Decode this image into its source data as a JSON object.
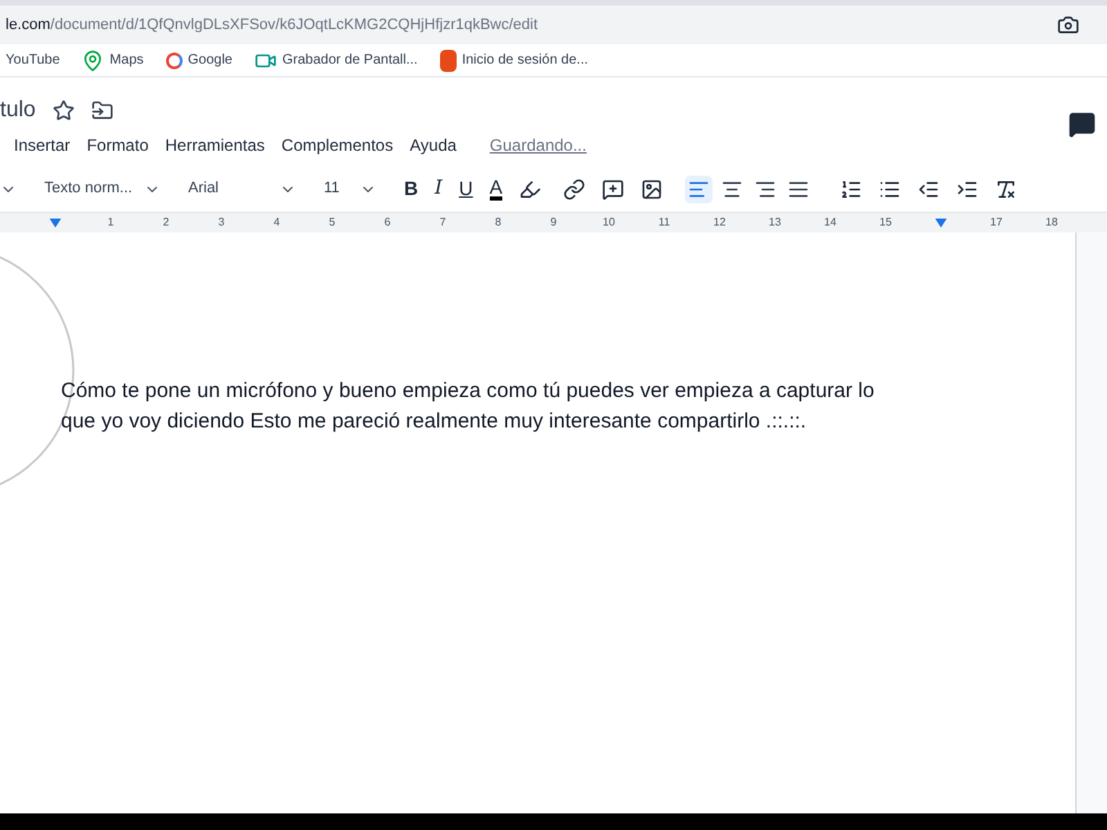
{
  "address_bar": {
    "domain": "le.com",
    "path": "/document/d/1QfQnvlgDLsXFSov/k6JOqtLcKMG2CQHjHfjzr1qkBwc/edit"
  },
  "bookmarks": [
    {
      "label": "YouTube",
      "kind": "plain"
    },
    {
      "label": "Maps",
      "kind": "pin"
    },
    {
      "label": "Google",
      "kind": "google"
    },
    {
      "label": "Grabador de Pantall...",
      "kind": "recorder"
    },
    {
      "label": "Inicio de sesión de...",
      "kind": "office"
    }
  ],
  "document_title": "tulo",
  "menu": [
    "Insertar",
    "Formato",
    "Herramientas",
    "Complementos",
    "Ayuda"
  ],
  "save_status": "Guardando...",
  "toolbar": {
    "style": "Texto norm...",
    "font": "Arial",
    "size": "11",
    "format_buttons": [
      {
        "label": "B",
        "kind": "bold"
      },
      {
        "label": "I",
        "kind": "italic"
      },
      {
        "label": "U",
        "kind": "underline"
      },
      {
        "label": "A",
        "kind": "color"
      }
    ],
    "align": [
      {
        "kind": "left",
        "selected": true
      },
      {
        "kind": "center",
        "selected": false
      },
      {
        "kind": "right",
        "selected": false
      },
      {
        "kind": "justify",
        "selected": false
      }
    ]
  },
  "ruler": [
    {
      "kind": "blank"
    },
    {
      "kind": "marker"
    },
    {
      "kind": "number",
      "label": "1"
    },
    {
      "kind": "number",
      "label": "2"
    },
    {
      "kind": "number",
      "label": "3"
    },
    {
      "kind": "number",
      "label": "4"
    },
    {
      "kind": "number",
      "label": "5"
    },
    {
      "kind": "number",
      "label": "6"
    },
    {
      "kind": "number",
      "label": "7"
    },
    {
      "kind": "number",
      "label": "8"
    },
    {
      "kind": "number",
      "label": "9"
    },
    {
      "kind": "number",
      "label": "10"
    },
    {
      "kind": "number",
      "label": "11"
    },
    {
      "kind": "number",
      "label": "12"
    },
    {
      "kind": "number",
      "label": "13"
    },
    {
      "kind": "number",
      "label": "14"
    },
    {
      "kind": "number",
      "label": "15"
    },
    {
      "kind": "marker"
    },
    {
      "kind": "number",
      "label": "17"
    },
    {
      "kind": "number",
      "label": "18"
    }
  ],
  "body_text": "Cómo te pone un micrófono y bueno empieza como tú puedes ver empieza a capturar lo que yo voy diciendo Esto me pareció realmente muy interesante compartirlo .::.::."
}
